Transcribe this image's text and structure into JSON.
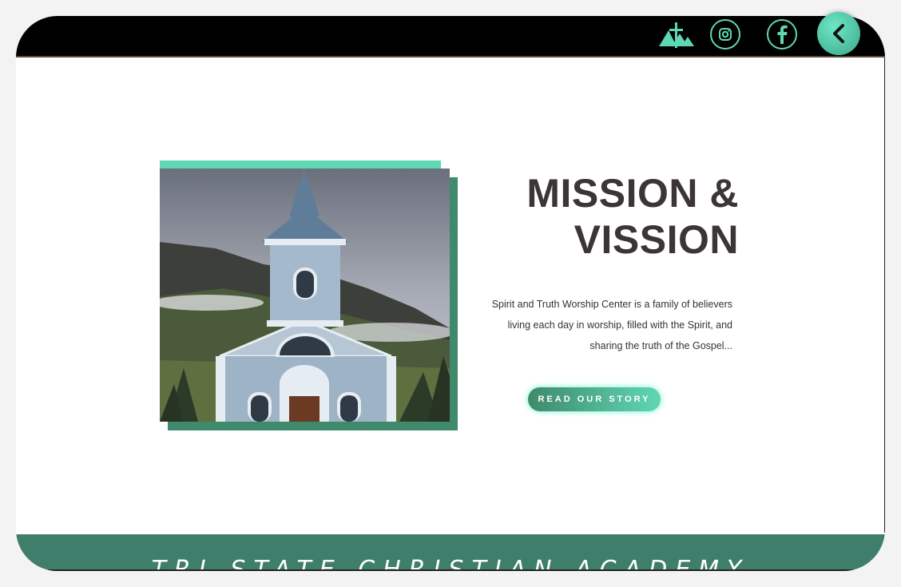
{
  "header": {
    "social": [
      {
        "icon": "instagram-icon"
      },
      {
        "icon": "facebook-icon"
      }
    ],
    "logo_icon": "church-logo-icon",
    "back_icon": "chevron-left-icon"
  },
  "colors": {
    "accent": "#5fd7b3",
    "accent_dark": "#3f8a6c",
    "heading": "#3b3535",
    "footer": "#3f7e6b"
  },
  "mission": {
    "heading_line1": "MISSION &",
    "heading_line2": "VISSION",
    "paragraph_line1": "Spirit and Truth Worship Center is a family of believers",
    "paragraph_line2": "living each day in worship, filled with the Spirit, and",
    "paragraph_line3": "sharing the truth of the Gospel...",
    "cta_label": "READ OUR STORY"
  },
  "footer": {
    "title": "TRI-STATE CHRISTIAN ACADEMY"
  }
}
